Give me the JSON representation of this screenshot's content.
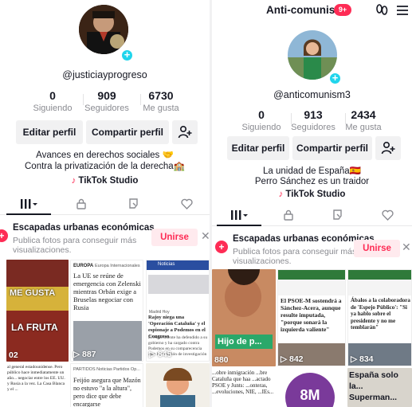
{
  "left": {
    "handle": "@justiciayprogreso",
    "stats": [
      {
        "value": "0",
        "label": "Siguiendo"
      },
      {
        "value": "909",
        "label": "Seguidores"
      },
      {
        "value": "6730",
        "label": "Me gusta"
      }
    ],
    "edit_label": "Editar perfil",
    "share_label": "Compartir perfil",
    "bio_line1": "Avances en derechos sociales 🤝",
    "bio_line2": "Contra la privatización de la derecha🏫",
    "studio_label": "TikTok Studio",
    "promo": {
      "title": "Escapadas urbanas económicas",
      "text_line1": "Publica fotos para conseguir más",
      "text_line2": "visualizaciones.",
      "join_label": "Unirse"
    },
    "videos": [
      {
        "views": "02",
        "overlay_text": [
          "ME GUSTA",
          "LA FRUTA"
        ]
      },
      {
        "views": "887",
        "source": "EUROPA",
        "nav": "Europa   Internacionales",
        "headline": "La UE se reúne de emergencia con Zelenski mientras Orbán exige a Bruselas negociar con Rusia"
      },
      {
        "views": "845",
        "source": "Noticias",
        "kicker": "Madrid Hoy",
        "headline": "Rajoy niega una 'Operación Cataluña' y el espionaje a Podemos en el Congreso",
        "sub": "El expresidente ha defendido a su gobierno y ha cargado contra Podemos en su comparecencia ante la comisión de investigación"
      },
      {
        "text": "al general estadounidense. Pero público hace inmediatamente un año... negociar entre los EE. UU. y Rusia a la vez. La Casa Blanca y el ..."
      },
      {
        "nav": "PARTIDOS   Noticias   Partidos   Op...",
        "headline": "Feijóo asegura que Mazón no estuvo \"a la altura\", pero dice que debe encargarse"
      },
      {}
    ]
  },
  "right": {
    "username": "Anti-comunism",
    "badge": "9+",
    "handle": "@anticomunism3",
    "stats": [
      {
        "value": "0",
        "label": "Siguiendo"
      },
      {
        "value": "913",
        "label": "Seguidores"
      },
      {
        "value": "2434",
        "label": "Me gusta"
      }
    ],
    "edit_label": "Editar perfil",
    "share_label": "Compartir perfil",
    "bio_line1": "La unidad de España🇪🇸",
    "bio_line2": "Perro Sánchez es un traidor",
    "studio_label": "TikTok Studio",
    "promo": {
      "title": "Escapadas urbanas económicas",
      "text_line1": "Publica fotos para conseguir más",
      "text_line2": "visualizaciones.",
      "join_label": "Unirse"
    },
    "videos": [
      {
        "views": "880",
        "caption": "Hijo de p..."
      },
      {
        "views": "842",
        "headline": "El PSOE-M sostendrá a Sánchez-Acera, aunque resulte imputada, \"porque sonará la izquierda valiente\""
      },
      {
        "views": "834",
        "headline": "Ábalos a la colaboradora de 'Espejo Público': \"Si ya hablo sobre el presidente y no me temblarán\""
      },
      {
        "text": "...obre inmigración ...bre Cataluña que haa ...actado PSOE y Junts: ...onteras, ...evoluciones, NIE, ...IEs..."
      },
      {
        "badge": "8M"
      },
      {
        "overlay_text": "España solo la... Superman..."
      }
    ]
  }
}
